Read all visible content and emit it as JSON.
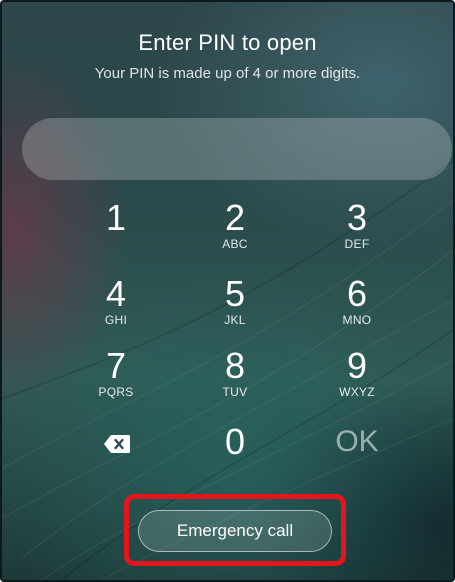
{
  "lock_screen": {
    "title": "Enter PIN to open",
    "subtitle": "Your PIN is made up of 4 or more digits."
  },
  "keypad": {
    "keys": [
      {
        "digit": "1",
        "letters": ""
      },
      {
        "digit": "2",
        "letters": "ABC"
      },
      {
        "digit": "3",
        "letters": "DEF"
      },
      {
        "digit": "4",
        "letters": "GHI"
      },
      {
        "digit": "5",
        "letters": "JKL"
      },
      {
        "digit": "6",
        "letters": "MNO"
      },
      {
        "digit": "7",
        "letters": "PQRS"
      },
      {
        "digit": "8",
        "letters": "TUV"
      },
      {
        "digit": "9",
        "letters": "WXYZ"
      },
      {
        "digit": "0",
        "letters": ""
      }
    ],
    "ok_label": "OK",
    "backspace_icon": "backspace-icon"
  },
  "emergency": {
    "label": "Emergency call",
    "highlight_color": "#e3161c"
  },
  "colors": {
    "text": "#ffffff",
    "highlight": "#e3161c"
  }
}
